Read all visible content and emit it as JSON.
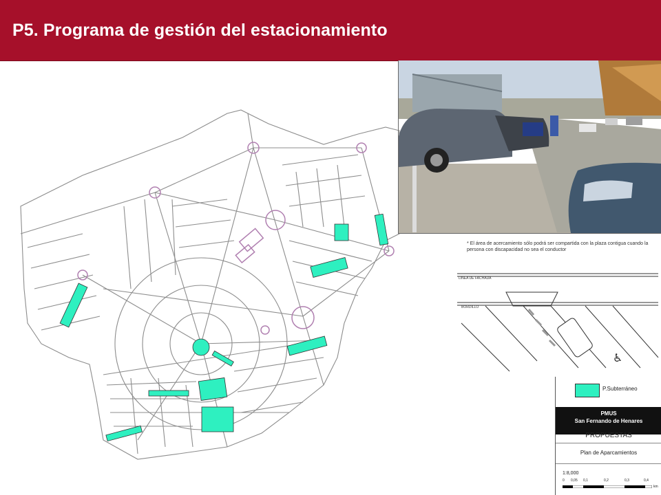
{
  "header": {
    "title": "P5. Programa de gestión del estacionamiento"
  },
  "colors": {
    "header_bg": "#a6102a",
    "parking_fill": "#2ef0c0",
    "street_line": "#8c8c8c",
    "roundabout": "#b07fb0"
  },
  "diagram": {
    "note": "* El área de acercamiento sólo podrá ser compartida con la plaza contigua cuando la persona con discapacidad no sea el conductor",
    "label_fachada": "LINEA DE FACHADA",
    "label_bordillo": "BORDILLO",
    "icon": "wheelchair-icon"
  },
  "legend": {
    "item": "P.Subterráneo",
    "title_line1": "PMUS",
    "title_line2": "San Fernando de Henares",
    "section": "PROPUESTAS",
    "plan": "Plan de Aparcamientos",
    "scale": "1:8,000",
    "scale_ticks": [
      "0",
      "0,05",
      "0,1",
      "0,2",
      "0,3",
      "0,4"
    ],
    "scale_unit": "km"
  },
  "photo": {
    "description_icon": "parked-cars-photo"
  }
}
